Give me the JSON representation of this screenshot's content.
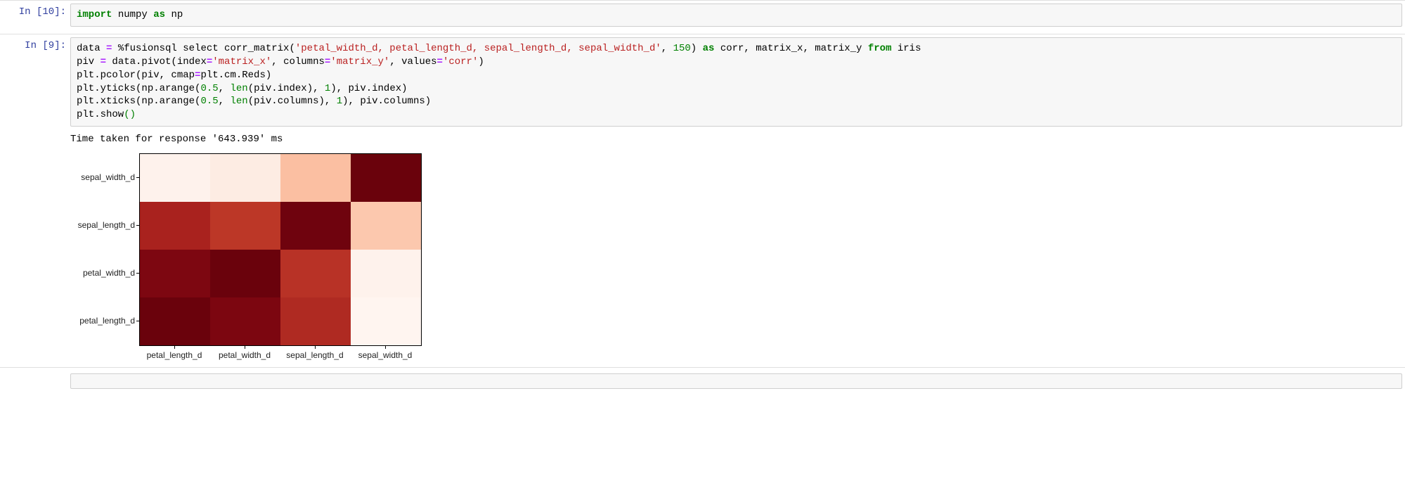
{
  "cells": {
    "cell1": {
      "prompt_label": "In [",
      "prompt_num": "10",
      "prompt_close": "]:",
      "code": {
        "t1": "import",
        "t2": " numpy ",
        "t3": "as",
        "t4": " np"
      }
    },
    "cell2": {
      "prompt_label": "In [",
      "prompt_num": "9",
      "prompt_close": "]:",
      "code": {
        "l1a": "data ",
        "l1op": "=",
        "l1b": " %fusionsql select corr_matrix(",
        "l1s1": "'petal_width_d, petal_length_d, sepal_length_d, sepal_width_d'",
        "l1c": ", ",
        "l1n": "150",
        "l1d": ") ",
        "l1as": "as",
        "l1e": " corr, matrix_x, matrix_y ",
        "l1from": "from",
        "l1f": " iris",
        "l2a": "piv ",
        "l2op": "=",
        "l2b": " data.pivot(index",
        "l2op2": "=",
        "l2s1": "'matrix_x'",
        "l2c": ", columns",
        "l2op3": "=",
        "l2s2": "'matrix_y'",
        "l2d": ", values",
        "l2op4": "=",
        "l2s3": "'corr'",
        "l2e": ")",
        "l3a": "plt.pcolor(piv, cmap",
        "l3op": "=",
        "l3b": "plt.cm.Reds)",
        "l4a": "plt.yticks(np.arange(",
        "l4n1": "0.5",
        "l4b": ", ",
        "l4fn": "len",
        "l4c": "(piv.index), ",
        "l4n2": "1",
        "l4d": "), piv.index)",
        "l5a": "plt.xticks(np.arange(",
        "l5n1": "0.5",
        "l5b": ", ",
        "l5fn": "len",
        "l5c": "(piv.columns), ",
        "l5n2": "1",
        "l5d": "), piv.columns)",
        "l6a": "plt.show",
        "l6p1": "(",
        "l6p2": ")"
      },
      "output_text": "Time taken for response '643.939' ms"
    }
  },
  "chart_data": {
    "type": "heatmap",
    "title": "",
    "x_categories": [
      "petal_length_d",
      "petal_width_d",
      "sepal_length_d",
      "sepal_width_d"
    ],
    "y_categories_top_to_bottom": [
      "sepal_width_d",
      "sepal_length_d",
      "petal_width_d",
      "petal_length_d"
    ],
    "values_top_to_bottom": [
      [
        0.05,
        0.07,
        0.3,
        1.0
      ],
      [
        0.82,
        0.75,
        1.0,
        0.3
      ],
      [
        0.95,
        1.0,
        0.75,
        0.1
      ],
      [
        1.0,
        0.95,
        0.78,
        0.1
      ]
    ],
    "colormap": "Reds",
    "value_range": [
      0,
      1
    ],
    "colors_top_to_bottom": [
      [
        "#fef2ec",
        "#fdece3",
        "#fbbfa2",
        "#6a020c"
      ],
      [
        "#a9221e",
        "#bc3727",
        "#6f030e",
        "#fcc8ae"
      ],
      [
        "#7d0711",
        "#6a020c",
        "#b83226",
        "#fef2ec"
      ],
      [
        "#6a020c",
        "#7c0610",
        "#af2a22",
        "#fff5f0"
      ]
    ]
  }
}
